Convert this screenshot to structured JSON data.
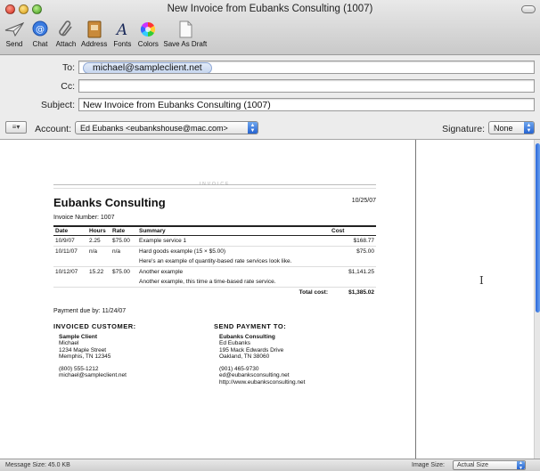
{
  "window": {
    "title": "New Invoice from Eubanks Consulting (1007)"
  },
  "toolbar": {
    "items": [
      {
        "label": "Send",
        "icon": "paper-plane-icon"
      },
      {
        "label": "Chat",
        "icon": "chat-bubble-icon"
      },
      {
        "label": "Attach",
        "icon": "paperclip-icon"
      },
      {
        "label": "Address",
        "icon": "address-book-icon"
      },
      {
        "label": "Fonts",
        "icon": "font-a-icon"
      },
      {
        "label": "Colors",
        "icon": "color-wheel-icon"
      },
      {
        "label": "Save As Draft",
        "icon": "draft-document-icon"
      }
    ]
  },
  "fields": {
    "to_label": "To:",
    "to_value": "michael@sampleclient.net",
    "cc_label": "Cc:",
    "cc_value": "",
    "subject_label": "Subject:",
    "subject_value": "New Invoice from Eubanks Consulting (1007)",
    "account_label": "Account:",
    "account_value": "Ed Eubanks <eubankshouse@mac.com>",
    "signature_label": "Signature:",
    "signature_value": "None"
  },
  "invoice": {
    "banner": "INVOICE",
    "company": "Eubanks Consulting",
    "date": "10/25/07",
    "number_line": "Invoice Number: 1007",
    "headers": [
      "Date",
      "Hours",
      "Rate",
      "Summary",
      "Cost"
    ],
    "rows": [
      {
        "date": "10/9/07",
        "hours": "2.25",
        "rate": "$75.00",
        "summary": "Example service 1",
        "cost": "$168.77"
      },
      {
        "date": "10/11/07",
        "hours": "n/a",
        "rate": "n/a",
        "summary": "Hard goods example (15 × $5.00)",
        "cost": "$75.00"
      },
      {
        "date": "",
        "hours": "",
        "rate": "",
        "summary": "Here's an example of quantity-based rate services look like.",
        "cost": ""
      },
      {
        "date": "10/12/07",
        "hours": "15.22",
        "rate": "$75.00",
        "summary": "Another example",
        "cost": "$1,141.25"
      },
      {
        "date": "",
        "hours": "",
        "rate": "",
        "summary": "Another example, this time a time-based rate service.",
        "cost": ""
      }
    ],
    "total_label": "Total cost:",
    "total_value": "$1,385.02",
    "payment_due": "Payment due by: 11/24/07",
    "customer": {
      "heading": "INVOICED CUSTOMER:",
      "name": "Sample Client",
      "contact": "Michael",
      "street": "1234 Maple Street",
      "city": "Memphis, TN 12345",
      "phone": "(800) 555-1212",
      "email": "michael@sampleclient.net"
    },
    "payee": {
      "heading": "SEND PAYMENT TO:",
      "name": "Eubanks Consulting",
      "contact": "Ed Eubanks",
      "street": "195 Mack Edwards Drive",
      "city": "Oakland, TN 38060",
      "phone": "(901) 465-9730",
      "email": "ed@eubanksconsulting.net",
      "web": "http://www.eubanksconsulting.net"
    }
  },
  "statusbar": {
    "message_size": "Message Size: 45.0 KB",
    "image_size_label": "Image Size:",
    "image_size_value": "Actual Size"
  }
}
